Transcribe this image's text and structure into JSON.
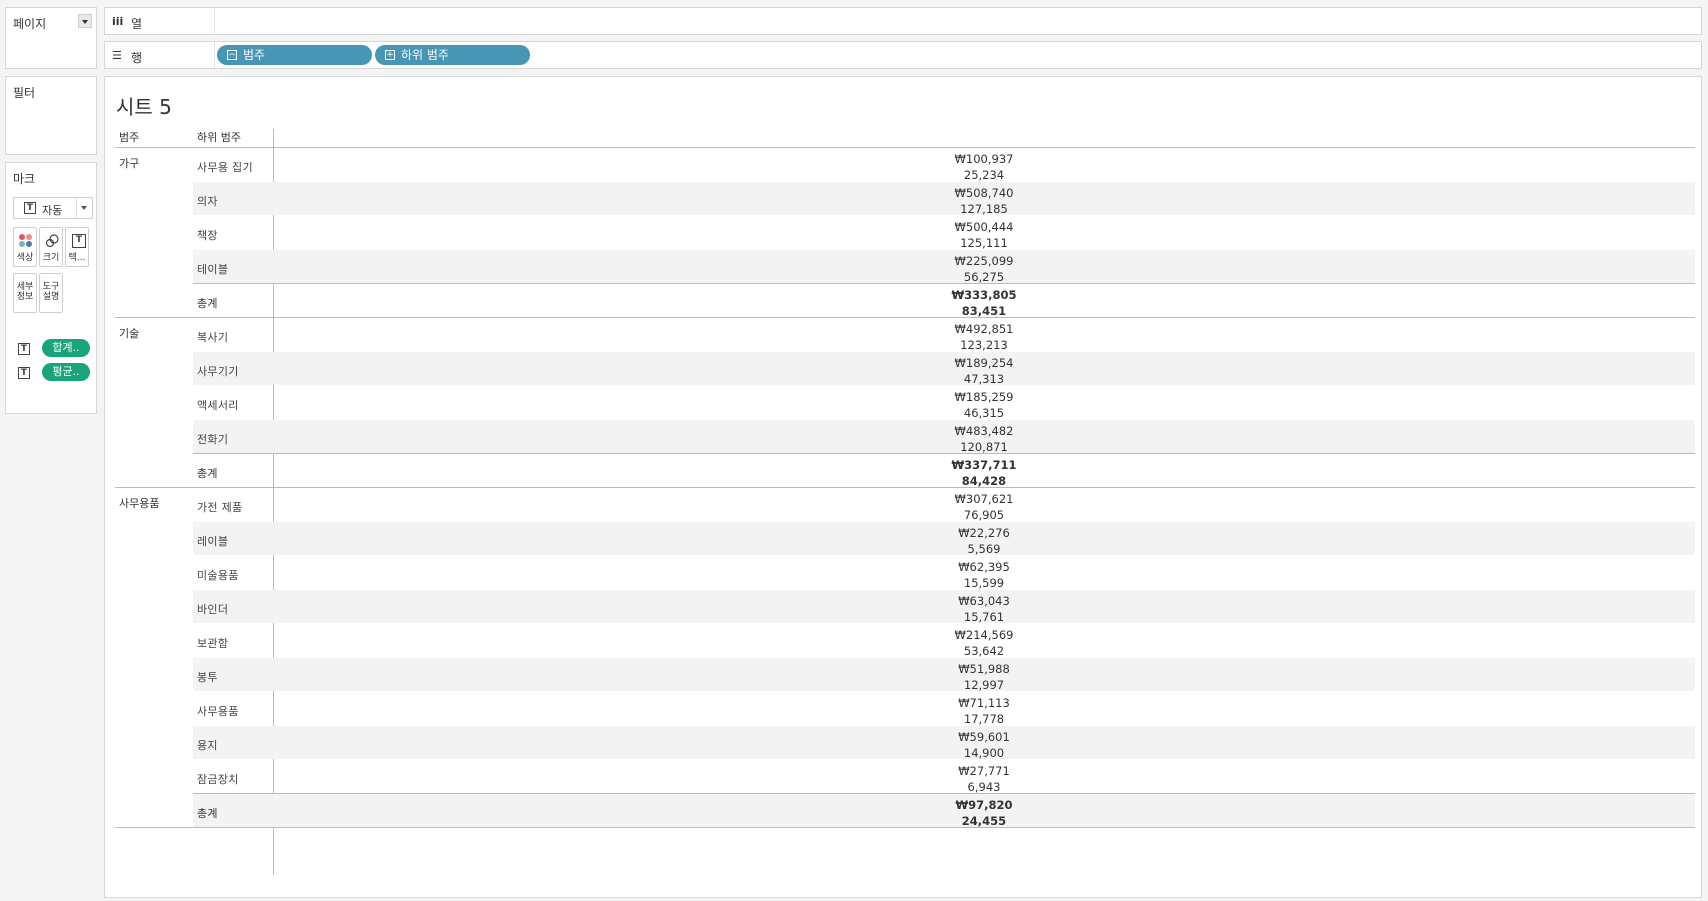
{
  "left": {
    "pages_label": "페이지",
    "filters_label": "필터",
    "marks_label": "마크",
    "mark_type": "자동",
    "mark_buttons": {
      "color": "색상",
      "size": "크기",
      "text": "텍...",
      "detail": "세부 정보",
      "tooltip": "도구 설명"
    },
    "mark_pills": [
      "합계..",
      "평균.."
    ]
  },
  "shelves": {
    "columns_label": "열",
    "rows_label": "행",
    "row_pills": [
      "범주",
      "하위 범주"
    ]
  },
  "sheet": {
    "title": "시트 5",
    "header_category": "범주",
    "header_subcategory": "하위 범주",
    "groups": [
      {
        "category": "가구",
        "rows": [
          {
            "sub": "사무용 집기",
            "v1": "₩100,937",
            "v2": "25,234"
          },
          {
            "sub": "의자",
            "v1": "₩508,740",
            "v2": "127,185"
          },
          {
            "sub": "책장",
            "v1": "₩500,444",
            "v2": "125,111"
          },
          {
            "sub": "테이블",
            "v1": "₩225,099",
            "v2": "56,275"
          }
        ],
        "total": {
          "sub": "총계",
          "v1": "₩333,805",
          "v2": "83,451"
        }
      },
      {
        "category": "기술",
        "rows": [
          {
            "sub": "복사기",
            "v1": "₩492,851",
            "v2": "123,213"
          },
          {
            "sub": "사무기기",
            "v1": "₩189,254",
            "v2": "47,313"
          },
          {
            "sub": "액세서리",
            "v1": "₩185,259",
            "v2": "46,315"
          },
          {
            "sub": "전화기",
            "v1": "₩483,482",
            "v2": "120,871"
          }
        ],
        "total": {
          "sub": "총계",
          "v1": "₩337,711",
          "v2": "84,428"
        }
      },
      {
        "category": "사무용품",
        "rows": [
          {
            "sub": "가전 제품",
            "v1": "₩307,621",
            "v2": "76,905"
          },
          {
            "sub": "레이블",
            "v1": "₩22,276",
            "v2": "5,569"
          },
          {
            "sub": "미술용품",
            "v1": "₩62,395",
            "v2": "15,599"
          },
          {
            "sub": "바인더",
            "v1": "₩63,043",
            "v2": "15,761"
          },
          {
            "sub": "보관함",
            "v1": "₩214,569",
            "v2": "53,642"
          },
          {
            "sub": "봉투",
            "v1": "₩51,988",
            "v2": "12,997"
          },
          {
            "sub": "사무용품",
            "v1": "₩71,113",
            "v2": "17,778"
          },
          {
            "sub": "용지",
            "v1": "₩59,601",
            "v2": "14,900"
          },
          {
            "sub": "잠금장치",
            "v1": "₩27,771",
            "v2": "6,943"
          }
        ],
        "total": {
          "sub": "총계",
          "v1": "₩97,820",
          "v2": "24,455"
        }
      }
    ]
  },
  "colors": {
    "row_pill": "#4796b5",
    "mark_pill": "#1aa47d",
    "row_shade": "#f3f3f3"
  }
}
